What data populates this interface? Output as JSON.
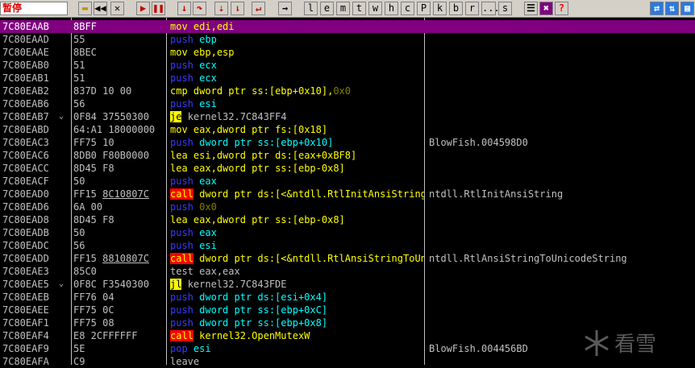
{
  "toolbar": {
    "status": "暂停",
    "letters": [
      "l",
      "e",
      "m",
      "t",
      "w",
      "h",
      "c",
      "P",
      "k",
      "b",
      "r",
      "...",
      "s"
    ],
    "icons": {
      "open": "folder-icon",
      "rewind": "rewind-icon",
      "close": "close-icon",
      "run": "play-icon",
      "pause": "pause-icon"
    }
  },
  "disasm": {
    "rows": [
      {
        "addr": "7C80EAAB",
        "hex": "8BFF",
        "mark": "",
        "type": "mov",
        "mn": "mov",
        "ops": "edi,edi",
        "cmt": "",
        "sel": true
      },
      {
        "addr": "7C80EAAD",
        "hex": "55",
        "mark": "",
        "type": "push",
        "mn": "push",
        "ops": "ebp",
        "cmt": ""
      },
      {
        "addr": "7C80EAAE",
        "hex": "8BEC",
        "mark": "",
        "type": "mov",
        "mn": "mov",
        "ops": "ebp,esp",
        "cmt": ""
      },
      {
        "addr": "7C80EAB0",
        "hex": "51",
        "mark": "",
        "type": "push",
        "mn": "push",
        "ops": "ecx",
        "cmt": ""
      },
      {
        "addr": "7C80EAB1",
        "hex": "51",
        "mark": "",
        "type": "push",
        "mn": "push",
        "ops": "ecx",
        "cmt": ""
      },
      {
        "addr": "7C80EAB2",
        "hex": "837D 10 00",
        "mark": "",
        "type": "cmp",
        "mn": "cmp",
        "ops": "dword ptr ss:[ebp+0x10],",
        "num": "0x0",
        "cmt": ""
      },
      {
        "addr": "7C80EAB6",
        "hex": "56",
        "mark": "",
        "type": "push",
        "mn": "push",
        "ops": "esi",
        "cmt": ""
      },
      {
        "addr": "7C80EAB7",
        "hex": "0F84 37550300",
        "mark": "⌄",
        "type": "jcc",
        "mn": "je",
        "ops": "kernel32.7C843FF4",
        "cmt": ""
      },
      {
        "addr": "7C80EABD",
        "hex": "64:A1 18000000",
        "mark": "",
        "type": "mov",
        "mn": "mov",
        "ops": "eax,dword ptr fs:[0x18]",
        "cmt": ""
      },
      {
        "addr": "7C80EAC3",
        "hex": "FF75 10",
        "mark": "",
        "type": "push",
        "mn": "push",
        "ops": "dword ptr ss:[ebp+0x10]",
        "cmt": "BlowFish.004598D0"
      },
      {
        "addr": "7C80EAC6",
        "hex": "8DB0 F80B0000",
        "mark": "",
        "type": "mov",
        "mn": "lea",
        "ops": "esi,dword ptr ds:[eax+0xBF8]",
        "cmt": ""
      },
      {
        "addr": "7C80EACC",
        "hex": "8D45 F8",
        "mark": "",
        "type": "mov",
        "mn": "lea",
        "ops": "eax,dword ptr ss:[ebp-0x8]",
        "cmt": ""
      },
      {
        "addr": "7C80EACF",
        "hex": "50",
        "mark": "",
        "type": "push",
        "mn": "push",
        "ops": "eax",
        "cmt": ""
      },
      {
        "addr": "7C80EAD0",
        "hex_a": "FF15 ",
        "hex_u": "8C10807C",
        "mark": "",
        "type": "call",
        "mn": "call",
        "ops": "dword ptr ds:[<&ntdll.RtlInitAnsiString>]",
        "cmt": "ntdll.RtlInitAnsiString"
      },
      {
        "addr": "7C80EAD6",
        "hex": "6A 00",
        "mark": "",
        "type": "push",
        "mn": "push",
        "ops": "",
        "num": "0x0",
        "cmt": ""
      },
      {
        "addr": "7C80EAD8",
        "hex": "8D45 F8",
        "mark": "",
        "type": "mov",
        "mn": "lea",
        "ops": "eax,dword ptr ss:[ebp-0x8]",
        "cmt": ""
      },
      {
        "addr": "7C80EADB",
        "hex": "50",
        "mark": "",
        "type": "push",
        "mn": "push",
        "ops": "eax",
        "cmt": ""
      },
      {
        "addr": "7C80EADC",
        "hex": "56",
        "mark": "",
        "type": "push",
        "mn": "push",
        "ops": "esi",
        "cmt": ""
      },
      {
        "addr": "7C80EADD",
        "hex_a": "FF15 ",
        "hex_u": "8810807C",
        "mark": "",
        "type": "call",
        "mn": "call",
        "ops": "dword ptr ds:[<&ntdll.RtlAnsiStringToUnicodeString>]",
        "cmt": "ntdll.RtlAnsiStringToUnicodeString"
      },
      {
        "addr": "7C80EAE3",
        "hex": "85C0",
        "mark": "",
        "type": "test",
        "mn": "test",
        "ops": "eax,eax",
        "cmt": ""
      },
      {
        "addr": "7C80EAE5",
        "hex": "0F8C F3540300",
        "mark": "⌄",
        "type": "jcc",
        "mn": "jl",
        "ops": "kernel32.7C843FDE",
        "cmt": ""
      },
      {
        "addr": "7C80EAEB",
        "hex": "FF76 04",
        "mark": "",
        "type": "push",
        "mn": "push",
        "ops": "dword ptr ds:[esi+0x4]",
        "cmt": ""
      },
      {
        "addr": "7C80EAEE",
        "hex": "FF75 0C",
        "mark": "",
        "type": "push",
        "mn": "push",
        "ops": "dword ptr ss:[ebp+0xC]",
        "cmt": ""
      },
      {
        "addr": "7C80EAF1",
        "hex": "FF75 08",
        "mark": "",
        "type": "push",
        "mn": "push",
        "ops": "dword ptr ss:[ebp+0x8]",
        "cmt": ""
      },
      {
        "addr": "7C80EAF4",
        "hex": "E8 2CFFFFFF",
        "mark": "",
        "type": "call",
        "mn": "call",
        "ops": "kernel32.OpenMutexW",
        "cmt": ""
      },
      {
        "addr": "7C80EAF9",
        "hex": "5E",
        "mark": "",
        "type": "push",
        "mn": "pop",
        "ops": "esi",
        "cmt": "BlowFish.004456BD"
      },
      {
        "addr": "7C80EAFA",
        "hex": "C9",
        "mark": "",
        "type": "test",
        "mn": "leave",
        "ops": "",
        "cmt": ""
      }
    ]
  },
  "watermark": {
    "text": "看雪",
    "icon": "snowflake-icon"
  }
}
